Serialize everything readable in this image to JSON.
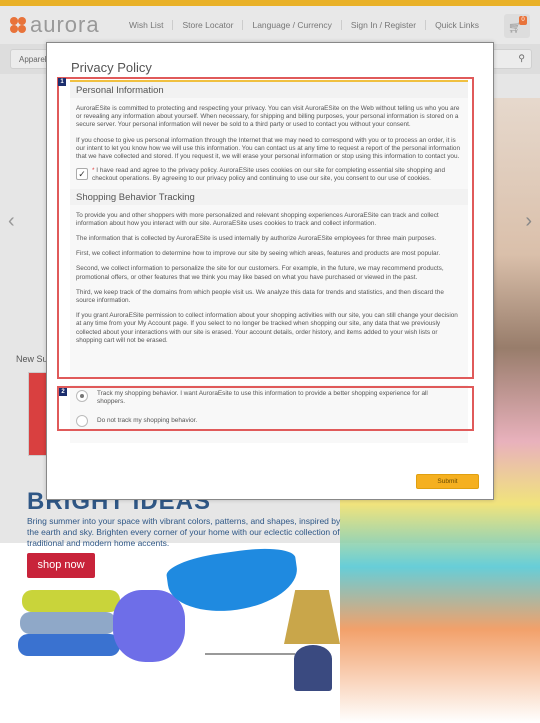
{
  "header": {
    "logo_text": "aurora",
    "links": [
      "Wish List",
      "Store Locator",
      "Language / Currency",
      "Sign In / Register",
      "Quick Links"
    ],
    "cart_count": "0"
  },
  "nav": {
    "first_item": "Apparel",
    "search_icon": "search-icon"
  },
  "hero": {
    "new_label": "New Su",
    "headline": "BRIGHT IDEAS",
    "body": "Bring summer into your space with vibrant colors, patterns, and shapes, inspired by the earth and sky. Brighten every corner of your home with our eclectic collection of traditional and modern home accents.",
    "cta": "shop now",
    "prev_arrow": "‹",
    "next_arrow": "›"
  },
  "modal": {
    "title": "Privacy Policy",
    "marker_1": "1",
    "marker_2": "2",
    "section1": {
      "heading": "Personal Information",
      "p1": "AuroraESite is committed to protecting and respecting your privacy. You can visit AuroraESite on the Web without telling us who you are or revealing any information about yourself. When necessary, for shipping and billing purposes, your personal information is stored on a secure server. Your personal information will never be sold to a third party or used to contact you without your consent.",
      "p2": "If you choose to give us personal information through the Internet that we may need to correspond with you or to process an order, it is our intent to let you know how we will use this information. You can contact us at any time to request a report of the personal information that we have collected and stored. If you request it, we will erase your personal information or stop using this information to contact you.",
      "consent_required": "*",
      "consent_text": " I have read and agree to the privacy policy. AuroraESite uses cookies on our site for completing essential site shopping and checkout operations. By agreeing to our privacy policy and continuing to use our site, you consent to our use of cookies.",
      "consent_checked": true
    },
    "section2": {
      "heading": "Shopping Behavior Tracking",
      "p1": "To provide you and other shoppers with more personalized and relevant shopping experiences AuroraESite can track and collect information about how you interact with our site. AuroraESite uses cookies to track and collect information.",
      "p2": "The information that is collected by AuroraESite is used internally by authorize AuroraESite employees for three main purposes.",
      "p3": "First, we collect information to determine how to improve our site by seeing which areas, features and products are most popular.",
      "p4": "Second, we collect information to personalize the site for our customers. For example, in the future, we may recommend products, promotional offers, or other features that we think you may like based on what you have purchased or viewed in the past.",
      "p5": "Third, we keep track of the domains from which people visit us. We analyze this data for trends and statistics, and then discard the source information.",
      "p6": "If you grant AuroraESite permission to collect information about your shopping activities with our site, you can still change your decision at any time from your My Account page. If you select to no longer be tracked when shopping our site, any data that we previously collected about your interactions with our site is erased. Your account details, order history, and items added to your wish lists or shopping cart will not be erased."
    },
    "tracking_options": [
      {
        "label": "Track my shopping behavior. I want AuroraEsite to use this information to provide a better shopping experience for all shoppers.",
        "selected": true
      },
      {
        "label": "Do not track my shopping behavior.",
        "selected": false
      }
    ],
    "submit_label": "Submit"
  },
  "colors": {
    "accent": "#e9b128",
    "brand_orange": "#e8733a",
    "cta_red": "#c8233a",
    "headline_blue": "#2f5786",
    "submit_yellow": "#f5b020",
    "highlight_red": "#e05a5a"
  }
}
